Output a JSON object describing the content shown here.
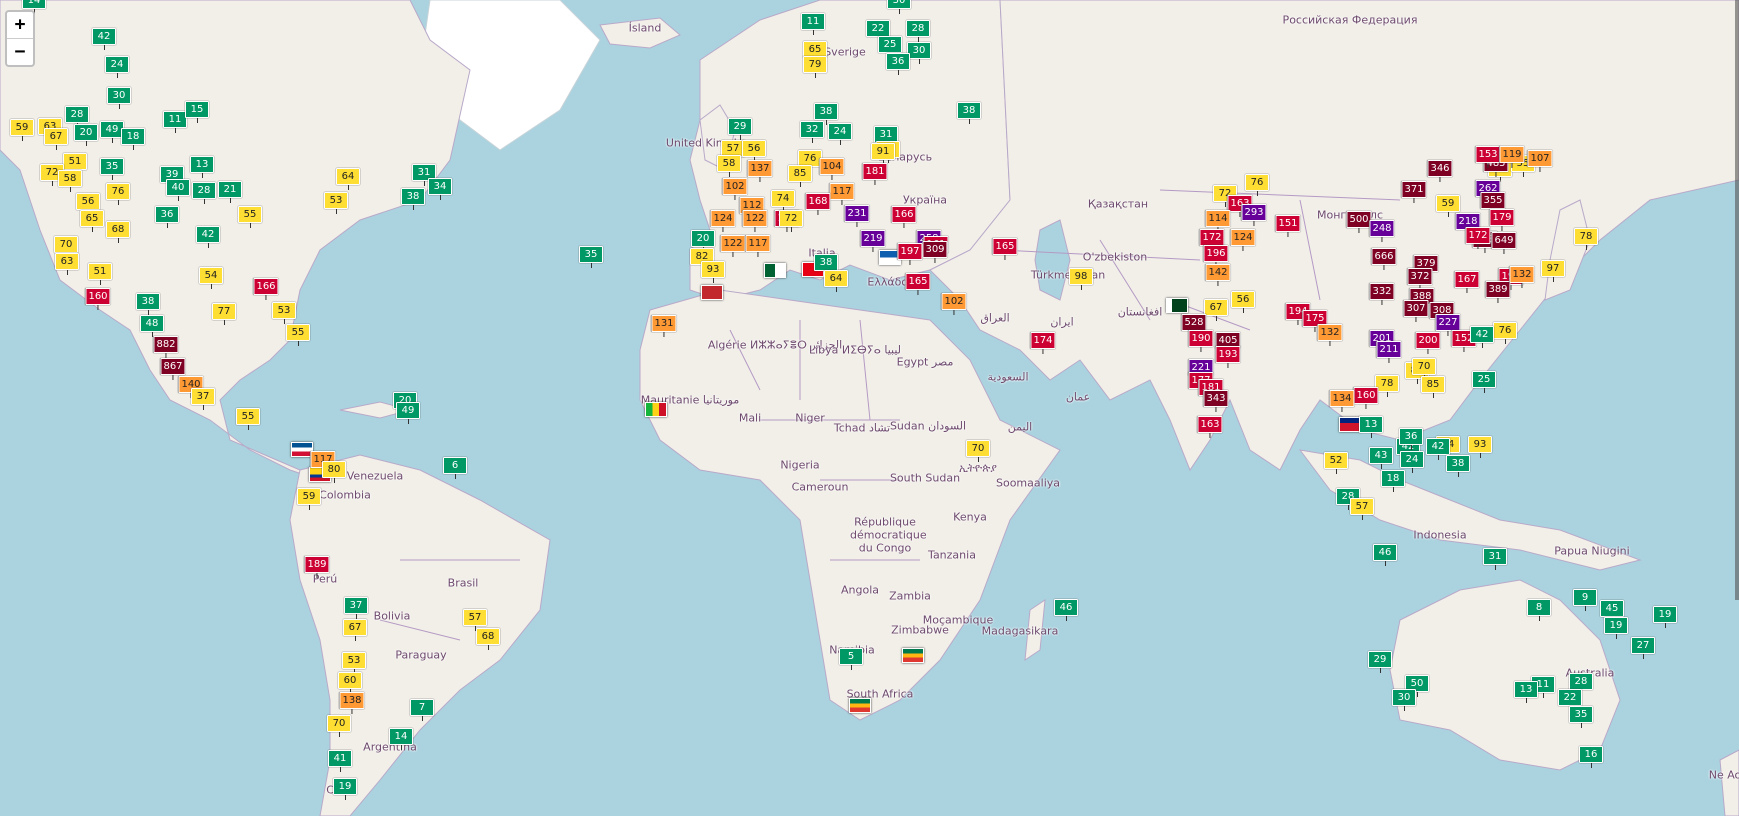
{
  "zoom": {
    "in_label": "+",
    "out_label": "−"
  },
  "colors": {
    "water": "#aad3df",
    "land": "#f2efe9",
    "good": "#009966",
    "moderate": "#ffde33",
    "unhealthy_sensitive": "#ff9933",
    "unhealthy": "#cc0033",
    "very_unhealthy": "#660099",
    "hazardous": "#7e0023"
  },
  "labels": [
    "Российская Федерация",
    "Ísland",
    "Sverige",
    "Беларусь",
    "Україна",
    "Қазақстан",
    "Монгол улс",
    "O'zbekiston",
    "Türkmenistan",
    "افغانستان",
    "ایران",
    "العراق",
    "السعودية",
    "عمان",
    "اليمن",
    "Ελλάδα",
    "Italia",
    "Algérie ⵍⵣⵣⴰⵢⴻⵔ الجزائر",
    "Libya ⵍⵉⴱⵢⴰ ليبيا",
    "Egypt مصر",
    "Mauritanie موريتانيا",
    "Mali",
    "Niger",
    "Tchad تشاد",
    "Sudan السودان",
    "Nigeria",
    "Cameroun",
    "South Sudan",
    "ኢትዮጵያ",
    "Soomaaliya",
    "Kenya",
    "République démocratique du Congo",
    "Tanzania",
    "Angola",
    "Zambia",
    "Moçambique",
    "Zimbabwe",
    "Madagasikara",
    "Namibia",
    "South Africa",
    "Venezuela",
    "Colombia",
    "Perú",
    "Brasil",
    "Bolivia",
    "Paraguay",
    "Argentina",
    "Chile",
    "Indonesia",
    "Papua Niugini",
    "Australia",
    "Ne Ao",
    "United Kingdom"
  ],
  "markers": [
    {
      "v": "14",
      "c": "good"
    },
    {
      "v": "42",
      "c": "good"
    },
    {
      "v": "24",
      "c": "good"
    },
    {
      "v": "30",
      "c": "good"
    },
    {
      "v": "11",
      "c": "good"
    },
    {
      "v": "15",
      "c": "good"
    },
    {
      "v": "59",
      "c": "mod"
    },
    {
      "v": "63",
      "c": "mod"
    },
    {
      "v": "67",
      "c": "mod"
    },
    {
      "v": "28",
      "c": "good"
    },
    {
      "v": "20",
      "c": "good"
    },
    {
      "v": "49",
      "c": "good"
    },
    {
      "v": "18",
      "c": "good"
    },
    {
      "v": "51",
      "c": "mod"
    },
    {
      "v": "72",
      "c": "mod"
    },
    {
      "v": "58",
      "c": "mod"
    },
    {
      "v": "76",
      "c": "mod"
    },
    {
      "v": "35",
      "c": "good"
    },
    {
      "v": "56",
      "c": "mod"
    },
    {
      "v": "39",
      "c": "good"
    },
    {
      "v": "13",
      "c": "good"
    },
    {
      "v": "40",
      "c": "good"
    },
    {
      "v": "28",
      "c": "good"
    },
    {
      "v": "21",
      "c": "good"
    },
    {
      "v": "65",
      "c": "mod"
    },
    {
      "v": "68",
      "c": "mod"
    },
    {
      "v": "36",
      "c": "good"
    },
    {
      "v": "42",
      "c": "good"
    },
    {
      "v": "55",
      "c": "mod"
    },
    {
      "v": "53",
      "c": "mod"
    },
    {
      "v": "64",
      "c": "mod"
    },
    {
      "v": "31",
      "c": "good"
    },
    {
      "v": "34",
      "c": "good"
    },
    {
      "v": "38",
      "c": "good"
    },
    {
      "v": "70",
      "c": "mod"
    },
    {
      "v": "63",
      "c": "mod"
    },
    {
      "v": "51",
      "c": "mod"
    },
    {
      "v": "38",
      "c": "good"
    },
    {
      "v": "160",
      "c": "unh"
    },
    {
      "v": "166",
      "c": "unh"
    },
    {
      "v": "54",
      "c": "mod"
    },
    {
      "v": "77",
      "c": "mod"
    },
    {
      "v": "53",
      "c": "mod"
    },
    {
      "v": "55",
      "c": "mod"
    },
    {
      "v": "48",
      "c": "good"
    },
    {
      "v": "882",
      "c": "haz"
    },
    {
      "v": "867",
      "c": "haz"
    },
    {
      "v": "140",
      "c": "usg"
    },
    {
      "v": "37",
      "c": "mod"
    },
    {
      "v": "55",
      "c": "mod"
    },
    {
      "v": "20",
      "c": "good"
    },
    {
      "v": "49",
      "c": "good"
    },
    {
      "v": "117",
      "c": "usg"
    },
    {
      "v": "80",
      "c": "mod"
    },
    {
      "v": "59",
      "c": "mod"
    },
    {
      "v": "6",
      "c": "good"
    },
    {
      "v": "189",
      "c": "unh"
    },
    {
      "v": "37",
      "c": "good"
    },
    {
      "v": "67",
      "c": "mod"
    },
    {
      "v": "57",
      "c": "mod"
    },
    {
      "v": "68",
      "c": "mod"
    },
    {
      "v": "53",
      "c": "mod"
    },
    {
      "v": "60",
      "c": "mod"
    },
    {
      "v": "138",
      "c": "usg"
    },
    {
      "v": "7",
      "c": "good"
    },
    {
      "v": "70",
      "c": "mod"
    },
    {
      "v": "14",
      "c": "good"
    },
    {
      "v": "41",
      "c": "good"
    },
    {
      "v": "19",
      "c": "good"
    },
    {
      "v": "35",
      "c": "good"
    },
    {
      "v": "30",
      "c": "good"
    },
    {
      "v": "11",
      "c": "good"
    },
    {
      "v": "65",
      "c": "mod"
    },
    {
      "v": "79",
      "c": "mod"
    },
    {
      "v": "22",
      "c": "good"
    },
    {
      "v": "28",
      "c": "good"
    },
    {
      "v": "25",
      "c": "good"
    },
    {
      "v": "30",
      "c": "good"
    },
    {
      "v": "36",
      "c": "good"
    },
    {
      "v": "38",
      "c": "good"
    },
    {
      "v": "38",
      "c": "good"
    },
    {
      "v": "29",
      "c": "good"
    },
    {
      "v": "57",
      "c": "mod"
    },
    {
      "v": "56",
      "c": "mod"
    },
    {
      "v": "76",
      "c": "mod"
    },
    {
      "v": "32",
      "c": "good"
    },
    {
      "v": "24",
      "c": "good"
    },
    {
      "v": "31",
      "c": "good"
    },
    {
      "v": "68",
      "c": "mod"
    },
    {
      "v": "91",
      "c": "mod"
    },
    {
      "v": "58",
      "c": "mod"
    },
    {
      "v": "137",
      "c": "usg"
    },
    {
      "v": "85",
      "c": "mod"
    },
    {
      "v": "104",
      "c": "usg"
    },
    {
      "v": "181",
      "c": "unh"
    },
    {
      "v": "102",
      "c": "usg"
    },
    {
      "v": "74",
      "c": "mod"
    },
    {
      "v": "117",
      "c": "usg"
    },
    {
      "v": "168",
      "c": "unh"
    },
    {
      "v": "112",
      "c": "usg"
    },
    {
      "v": "155",
      "c": "unh"
    },
    {
      "v": "231",
      "c": "vun"
    },
    {
      "v": "166",
      "c": "unh"
    },
    {
      "v": "124",
      "c": "usg"
    },
    {
      "v": "122",
      "c": "usg"
    },
    {
      "v": "72",
      "c": "mod"
    },
    {
      "v": "219",
      "c": "vun"
    },
    {
      "v": "258",
      "c": "vun"
    },
    {
      "v": "161",
      "c": "unh"
    },
    {
      "v": "165",
      "c": "unh"
    },
    {
      "v": "309",
      "c": "haz"
    },
    {
      "v": "197",
      "c": "unh"
    },
    {
      "v": "20",
      "c": "good"
    },
    {
      "v": "122",
      "c": "usg"
    },
    {
      "v": "117",
      "c": "usg"
    },
    {
      "v": "82",
      "c": "mod"
    },
    {
      "v": "93",
      "c": "mod"
    },
    {
      "v": "38",
      "c": "good"
    },
    {
      "v": "64",
      "c": "mod"
    },
    {
      "v": "165",
      "c": "unh"
    },
    {
      "v": "102",
      "c": "usg"
    },
    {
      "v": "131",
      "c": "usg"
    },
    {
      "v": "98",
      "c": "mod"
    },
    {
      "v": "174",
      "c": "unh"
    },
    {
      "v": "70",
      "c": "mod"
    },
    {
      "v": "72",
      "c": "mod"
    },
    {
      "v": "76",
      "c": "mod"
    },
    {
      "v": "163",
      "c": "unh"
    },
    {
      "v": "293",
      "c": "vun"
    },
    {
      "v": "151",
      "c": "unh"
    },
    {
      "v": "114",
      "c": "usg"
    },
    {
      "v": "172",
      "c": "unh"
    },
    {
      "v": "124",
      "c": "usg"
    },
    {
      "v": "196",
      "c": "unh"
    },
    {
      "v": "142",
      "c": "usg"
    },
    {
      "v": "56",
      "c": "mod"
    },
    {
      "v": "67",
      "c": "mod"
    },
    {
      "v": "528",
      "c": "haz"
    },
    {
      "v": "190",
      "c": "unh"
    },
    {
      "v": "405",
      "c": "haz"
    },
    {
      "v": "193",
      "c": "unh"
    },
    {
      "v": "221",
      "c": "vun"
    },
    {
      "v": "177",
      "c": "unh"
    },
    {
      "v": "181",
      "c": "unh"
    },
    {
      "v": "343",
      "c": "haz"
    },
    {
      "v": "163",
      "c": "unh"
    },
    {
      "v": "194",
      "c": "unh"
    },
    {
      "v": "175",
      "c": "unh"
    },
    {
      "v": "53",
      "c": "mod"
    },
    {
      "v": "55",
      "c": "mod"
    },
    {
      "v": "485",
      "c": "haz"
    },
    {
      "v": "153",
      "c": "unh"
    },
    {
      "v": "119",
      "c": "usg"
    },
    {
      "v": "107",
      "c": "usg"
    },
    {
      "v": "346",
      "c": "haz"
    },
    {
      "v": "371",
      "c": "haz"
    },
    {
      "v": "262",
      "c": "vun"
    },
    {
      "v": "355",
      "c": "haz"
    },
    {
      "v": "59",
      "c": "mod"
    },
    {
      "v": "218",
      "c": "vun"
    },
    {
      "v": "558",
      "c": "haz"
    },
    {
      "v": "649",
      "c": "haz"
    },
    {
      "v": "172",
      "c": "unh"
    },
    {
      "v": "179",
      "c": "unh"
    },
    {
      "v": "500",
      "c": "haz"
    },
    {
      "v": "248",
      "c": "vun"
    },
    {
      "v": "666",
      "c": "haz"
    },
    {
      "v": "379",
      "c": "haz"
    },
    {
      "v": "372",
      "c": "haz"
    },
    {
      "v": "192",
      "c": "unh"
    },
    {
      "v": "167",
      "c": "unh"
    },
    {
      "v": "389",
      "c": "haz"
    },
    {
      "v": "332",
      "c": "haz"
    },
    {
      "v": "388",
      "c": "haz"
    },
    {
      "v": "307",
      "c": "haz"
    },
    {
      "v": "308",
      "c": "haz"
    },
    {
      "v": "227",
      "c": "vun"
    },
    {
      "v": "201",
      "c": "vun"
    },
    {
      "v": "211",
      "c": "vun"
    },
    {
      "v": "200",
      "c": "unh"
    },
    {
      "v": "152",
      "c": "unh"
    },
    {
      "v": "132",
      "c": "usg"
    },
    {
      "v": "76",
      "c": "mod"
    },
    {
      "v": "25",
      "c": "good"
    },
    {
      "v": "42",
      "c": "good"
    },
    {
      "v": "85",
      "c": "mod"
    },
    {
      "v": "70",
      "c": "mod"
    },
    {
      "v": "78",
      "c": "mod"
    },
    {
      "v": "85",
      "c": "mod"
    },
    {
      "v": "160",
      "c": "unh"
    },
    {
      "v": "134",
      "c": "usg"
    },
    {
      "v": "13",
      "c": "good"
    },
    {
      "v": "52",
      "c": "mod"
    },
    {
      "v": "43",
      "c": "good"
    },
    {
      "v": "42",
      "c": "good"
    },
    {
      "v": "36",
      "c": "good"
    },
    {
      "v": "24",
      "c": "good"
    },
    {
      "v": "18",
      "c": "good"
    },
    {
      "v": "28",
      "c": "good"
    },
    {
      "v": "57",
      "c": "mod"
    },
    {
      "v": "74",
      "c": "mod"
    },
    {
      "v": "93",
      "c": "mod"
    },
    {
      "v": "42",
      "c": "good"
    },
    {
      "v": "38",
      "c": "good"
    },
    {
      "v": "46",
      "c": "good"
    },
    {
      "v": "31",
      "c": "good"
    },
    {
      "v": "29",
      "c": "good"
    },
    {
      "v": "50",
      "c": "good"
    },
    {
      "v": "30",
      "c": "good"
    },
    {
      "v": "8",
      "c": "good"
    },
    {
      "v": "9",
      "c": "good"
    },
    {
      "v": "45",
      "c": "good"
    },
    {
      "v": "19",
      "c": "good"
    },
    {
      "v": "27",
      "c": "good"
    },
    {
      "v": "11",
      "c": "good"
    },
    {
      "v": "13",
      "c": "good"
    },
    {
      "v": "28",
      "c": "good"
    },
    {
      "v": "22",
      "c": "good"
    },
    {
      "v": "35",
      "c": "good"
    },
    {
      "v": "16",
      "c": "good"
    },
    {
      "v": "19",
      "c": "good"
    },
    {
      "v": "5",
      "c": "good"
    },
    {
      "v": "46",
      "c": "good"
    },
    {
      "v": "78",
      "c": "mod"
    },
    {
      "v": "97",
      "c": "mod"
    },
    {
      "v": "132",
      "c": "usg"
    }
  ]
}
